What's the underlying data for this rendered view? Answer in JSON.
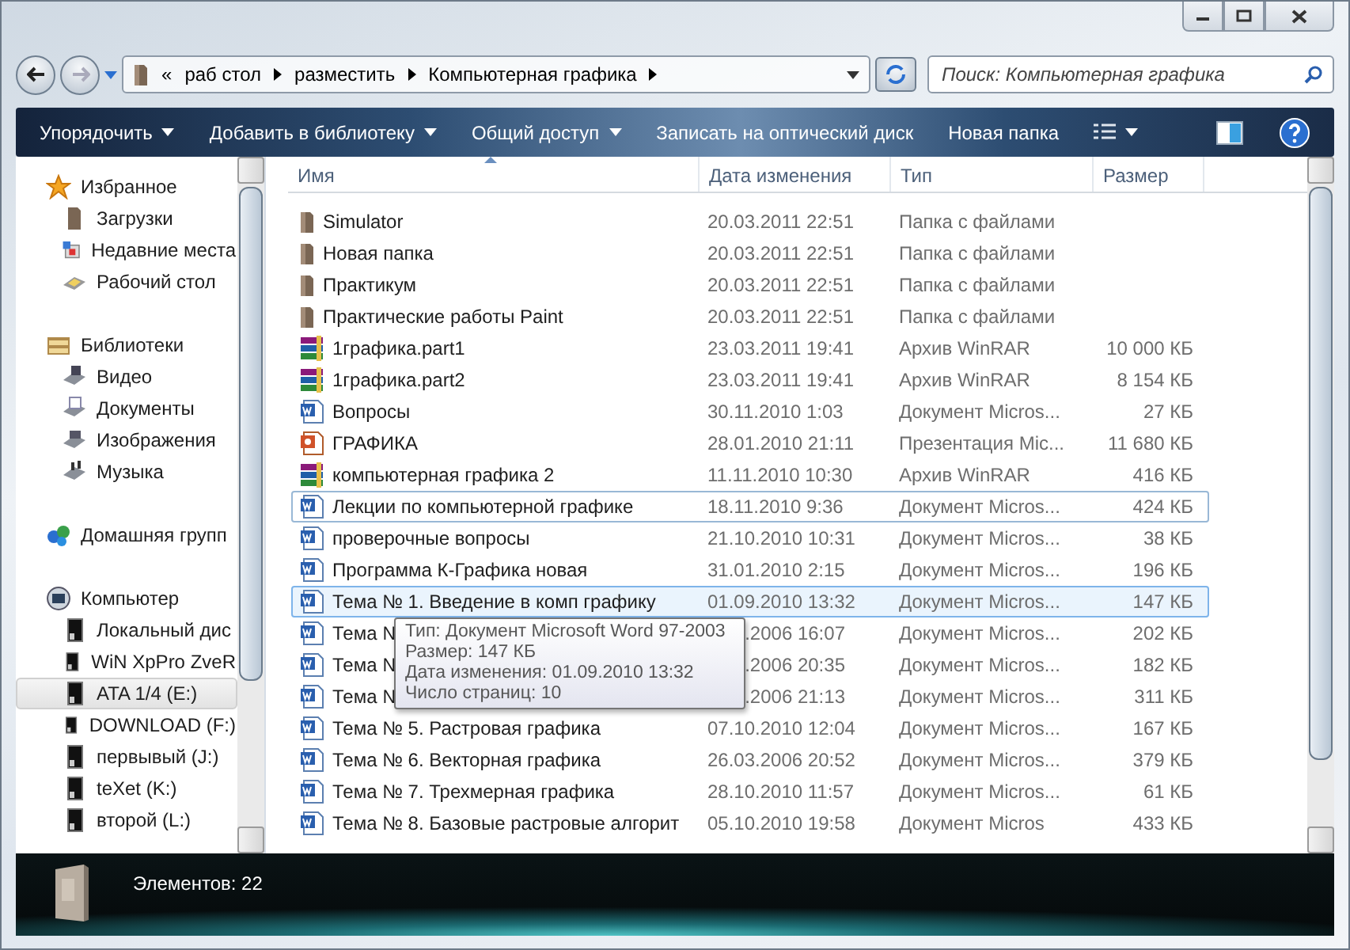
{
  "address": {
    "overflow": "«",
    "crumbs": [
      "раб стол",
      "разместить",
      "Компьютерная графика"
    ],
    "search_placeholder": "Поиск: Компьютерная графика"
  },
  "toolbar": [
    {
      "label": "Упорядочить",
      "dropdown": true
    },
    {
      "label": "Добавить в библиотеку",
      "dropdown": true
    },
    {
      "label": "Общий доступ",
      "dropdown": true
    },
    {
      "label": "Записать на оптический диск",
      "dropdown": false
    },
    {
      "label": "Новая папка",
      "dropdown": false
    }
  ],
  "nav": [
    {
      "label": "Избранное",
      "kind": "star",
      "selected": false,
      "children": [
        {
          "label": "Загрузки",
          "kind": "folder",
          "selected": false
        },
        {
          "label": "Недавние места",
          "kind": "recent",
          "selected": false
        },
        {
          "label": "Рабочий стол",
          "kind": "desktop",
          "selected": false
        }
      ]
    },
    {
      "label": "Библиотеки",
      "kind": "library",
      "selected": false,
      "children": [
        {
          "label": "Видео",
          "kind": "video",
          "selected": false
        },
        {
          "label": "Документы",
          "kind": "docs",
          "selected": false
        },
        {
          "label": "Изображения",
          "kind": "pictures",
          "selected": false
        },
        {
          "label": "Музыка",
          "kind": "music",
          "selected": false
        }
      ]
    },
    {
      "label": "Домашняя групп",
      "kind": "homegroup",
      "selected": false
    },
    {
      "label": "Компьютер",
      "kind": "computer",
      "selected": false,
      "children": [
        {
          "label": "Локальный дис",
          "kind": "drive",
          "selected": false
        },
        {
          "label": "WiN XpPro ZveR",
          "kind": "drive",
          "selected": false
        },
        {
          "label": "ATA 1/4 (E:)",
          "kind": "drive",
          "selected": true
        },
        {
          "label": "DOWNLOAD (F:)",
          "kind": "drive",
          "selected": false
        },
        {
          "label": "первывый (J:)",
          "kind": "drive",
          "selected": false
        },
        {
          "label": "teXet (K:)",
          "kind": "drive",
          "selected": false
        },
        {
          "label": "второй (L:)",
          "kind": "drive",
          "selected": false
        }
      ]
    }
  ],
  "table": {
    "columns": [
      "Имя",
      "Дата изменения",
      "Тип",
      "Размер"
    ],
    "rows": [
      {
        "kind": "folder",
        "name": "Simulator",
        "date": "20.03.2011 22:51",
        "type": "Папка с файлами",
        "focused": false,
        "hot": false,
        "covered": false
      },
      {
        "kind": "folder",
        "name": "Новая папка",
        "date": "20.03.2011 22:51",
        "type": "Папка с файлами",
        "focused": false,
        "hot": false,
        "covered": false
      },
      {
        "kind": "folder",
        "name": "Практикум",
        "date": "20.03.2011 22:51",
        "type": "Папка с файлами",
        "focused": false,
        "hot": false,
        "covered": false
      },
      {
        "kind": "folder",
        "name": "Практические работы Paint",
        "date": "20.03.2011 22:51",
        "type": "Папка с файлами",
        "focused": false,
        "hot": false,
        "covered": false
      },
      {
        "kind": "rar",
        "name": "1графика.part1",
        "date": "23.03.2011 19:41",
        "type": "Архив WinRAR",
        "size": "10 000 КБ",
        "focused": false,
        "hot": false,
        "covered": false
      },
      {
        "kind": "rar",
        "name": "1графика.part2",
        "date": "23.03.2011 19:41",
        "type": "Архив WinRAR",
        "size": "8 154 КБ",
        "focused": false,
        "hot": false,
        "covered": false
      },
      {
        "kind": "word",
        "name": "Вопросы",
        "date": "30.11.2010 1:03",
        "type": "Документ Micros...",
        "size": "27 КБ",
        "focused": false,
        "hot": false,
        "covered": false
      },
      {
        "kind": "ppt",
        "name": "ГРАФИКА",
        "date": "28.01.2010 21:11",
        "type": "Презентация Mic...",
        "size": "11 680 КБ",
        "focused": false,
        "hot": false,
        "covered": false
      },
      {
        "kind": "rar",
        "name": "компьютерная графика 2",
        "date": "11.11.2010 10:30",
        "type": "Архив WinRAR",
        "size": "416 КБ",
        "focused": false,
        "hot": false,
        "covered": false
      },
      {
        "kind": "word",
        "name": "Лекции по компьютерной графике",
        "date": "18.11.2010 9:36",
        "type": "Документ Micros...",
        "size": "424 КБ",
        "focused": true,
        "hot": false,
        "covered": false
      },
      {
        "kind": "word",
        "name": "проверочные вопросы",
        "date": "21.10.2010 10:31",
        "type": "Документ Micros...",
        "size": "38 КБ",
        "focused": false,
        "hot": false,
        "covered": false
      },
      {
        "kind": "word",
        "name": "Программа  К-Графика новая",
        "date": "31.01.2010 2:15",
        "type": "Документ Micros...",
        "size": "196 КБ",
        "focused": false,
        "hot": false,
        "covered": false
      },
      {
        "kind": "word",
        "name": "Тема № 1. Введение в комп графику",
        "date": "01.09.2010 13:32",
        "type": "Документ Micros...",
        "size": "147 КБ",
        "focused": true,
        "hot": true,
        "covered": false
      },
      {
        "kind": "word",
        "name": "Тема №",
        "date": ".2006 16:07",
        "type": "Документ Micros...",
        "size": "202 КБ",
        "focused": false,
        "hot": false,
        "covered": true
      },
      {
        "kind": "word",
        "name": "Тема №",
        "date": ".2006 20:35",
        "type": "Документ Micros...",
        "size": "182 КБ",
        "focused": false,
        "hot": false,
        "covered": true
      },
      {
        "kind": "word",
        "name": "Тема №",
        "date": ".2006 21:13",
        "type": "Документ Micros...",
        "size": "311 КБ",
        "focused": false,
        "hot": false,
        "covered": true
      },
      {
        "kind": "word",
        "name": "Тема № 5. Растровая графика",
        "date": "07.10.2010 12:04",
        "type": "Документ Micros...",
        "size": "167 КБ",
        "focused": false,
        "hot": false,
        "covered": false
      },
      {
        "kind": "word",
        "name": "Тема № 6. Векторная графика",
        "date": "26.03.2006 20:52",
        "type": "Документ Micros...",
        "size": "379 КБ",
        "focused": false,
        "hot": false,
        "covered": false
      },
      {
        "kind": "word",
        "name": "Тема № 7. Трехмерная графика",
        "date": "28.10.2010 11:57",
        "type": "Документ Micros...",
        "size": "61 КБ",
        "focused": false,
        "hot": false,
        "covered": false
      },
      {
        "kind": "word",
        "name": "Тема № 8. Базовые растровые алгорит",
        "date": "05.10.2010 19:58",
        "type": "Документ Micros",
        "size": "433 КБ",
        "focused": false,
        "hot": false,
        "covered": false
      }
    ]
  },
  "tooltip": [
    "Тип: Документ Microsoft Word 97-2003",
    "Размер: 147 КБ",
    "Дата изменения: 01.09.2010 13:32",
    "Число страниц: 10"
  ],
  "status": {
    "text": "Элементов: 22"
  }
}
